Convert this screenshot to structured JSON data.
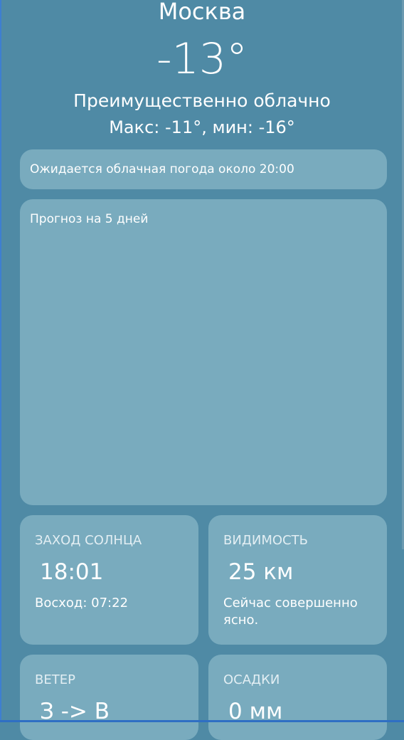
{
  "header": {
    "city": "Москва",
    "temperature": "-13°",
    "condition": "Преимущественно облачно",
    "range": "Макс: -11°, мин: -16°"
  },
  "banner": {
    "text": "Ожидается облачная погода около 20:00"
  },
  "forecast": {
    "title": "Прогноз на 5 дней"
  },
  "tiles": {
    "sunset": {
      "title": "ЗАХОД СОЛНЦА",
      "value": "18:01",
      "note": "Восход: 07:22"
    },
    "visibility": {
      "title": "ВИДИМОСТЬ",
      "value": "25 км",
      "note": "Сейчас совершенно ясно."
    },
    "wind": {
      "title": "ВЕТЕР",
      "value": "З -> В"
    },
    "precipitation": {
      "title": "ОСАДКИ",
      "value": "0 мм"
    }
  },
  "colors": {
    "background": "#4f8aa5",
    "card": "#79abbe",
    "text": "#ffffff"
  }
}
